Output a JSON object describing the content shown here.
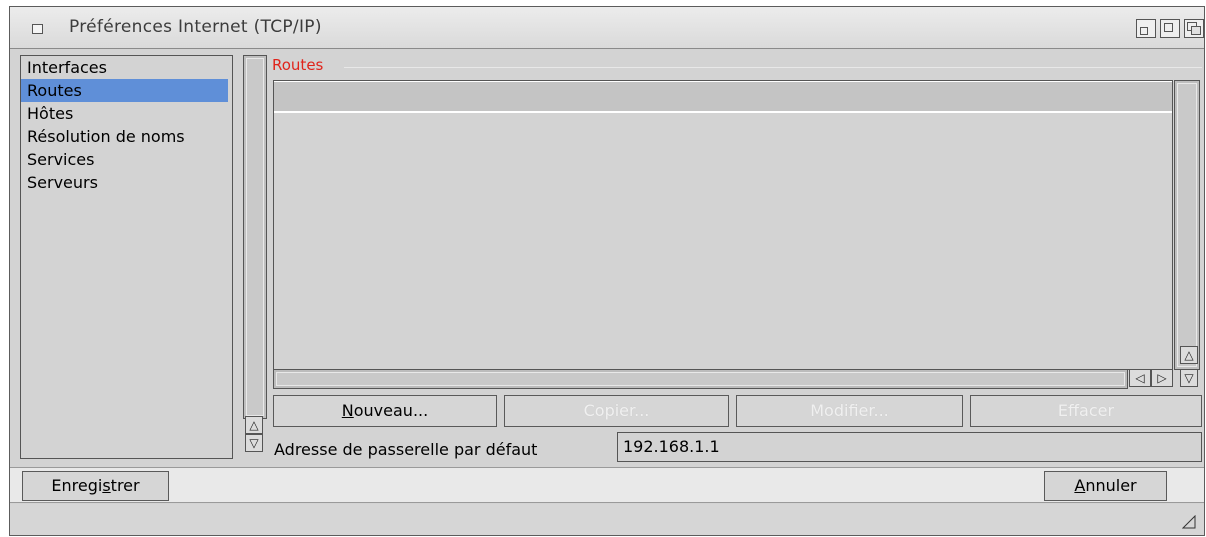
{
  "window": {
    "title": "Préférences Internet (TCP/IP)",
    "icons": [
      "close-icon",
      "iconify-icon",
      "zoom-icon",
      "depth-icon"
    ]
  },
  "sidebar": {
    "items": [
      {
        "label": "Interfaces",
        "selected": false
      },
      {
        "label": "Routes",
        "selected": true
      },
      {
        "label": "Hôtes",
        "selected": false
      },
      {
        "label": "Résolution de noms",
        "selected": false
      },
      {
        "label": "Services",
        "selected": false
      },
      {
        "label": "Serveurs",
        "selected": false
      }
    ]
  },
  "routes": {
    "group_label": "Routes",
    "rows": []
  },
  "buttons": {
    "new_mnemonic": "N",
    "new_rest": "ouveau...",
    "copy": "Copier...",
    "modify": "Modifier...",
    "delete": "Effacer"
  },
  "gateway": {
    "label": "Adresse de passerelle par défaut",
    "value": "192.168.1.1"
  },
  "footer": {
    "save_pre": "Enregi",
    "save_mnemonic": "s",
    "save_post": "trer",
    "cancel_mnemonic": "A",
    "cancel_rest": "nnuler"
  },
  "colors": {
    "selection": "#5f8fd8",
    "group_label": "#e0241b",
    "background": "#d3d3d3"
  }
}
